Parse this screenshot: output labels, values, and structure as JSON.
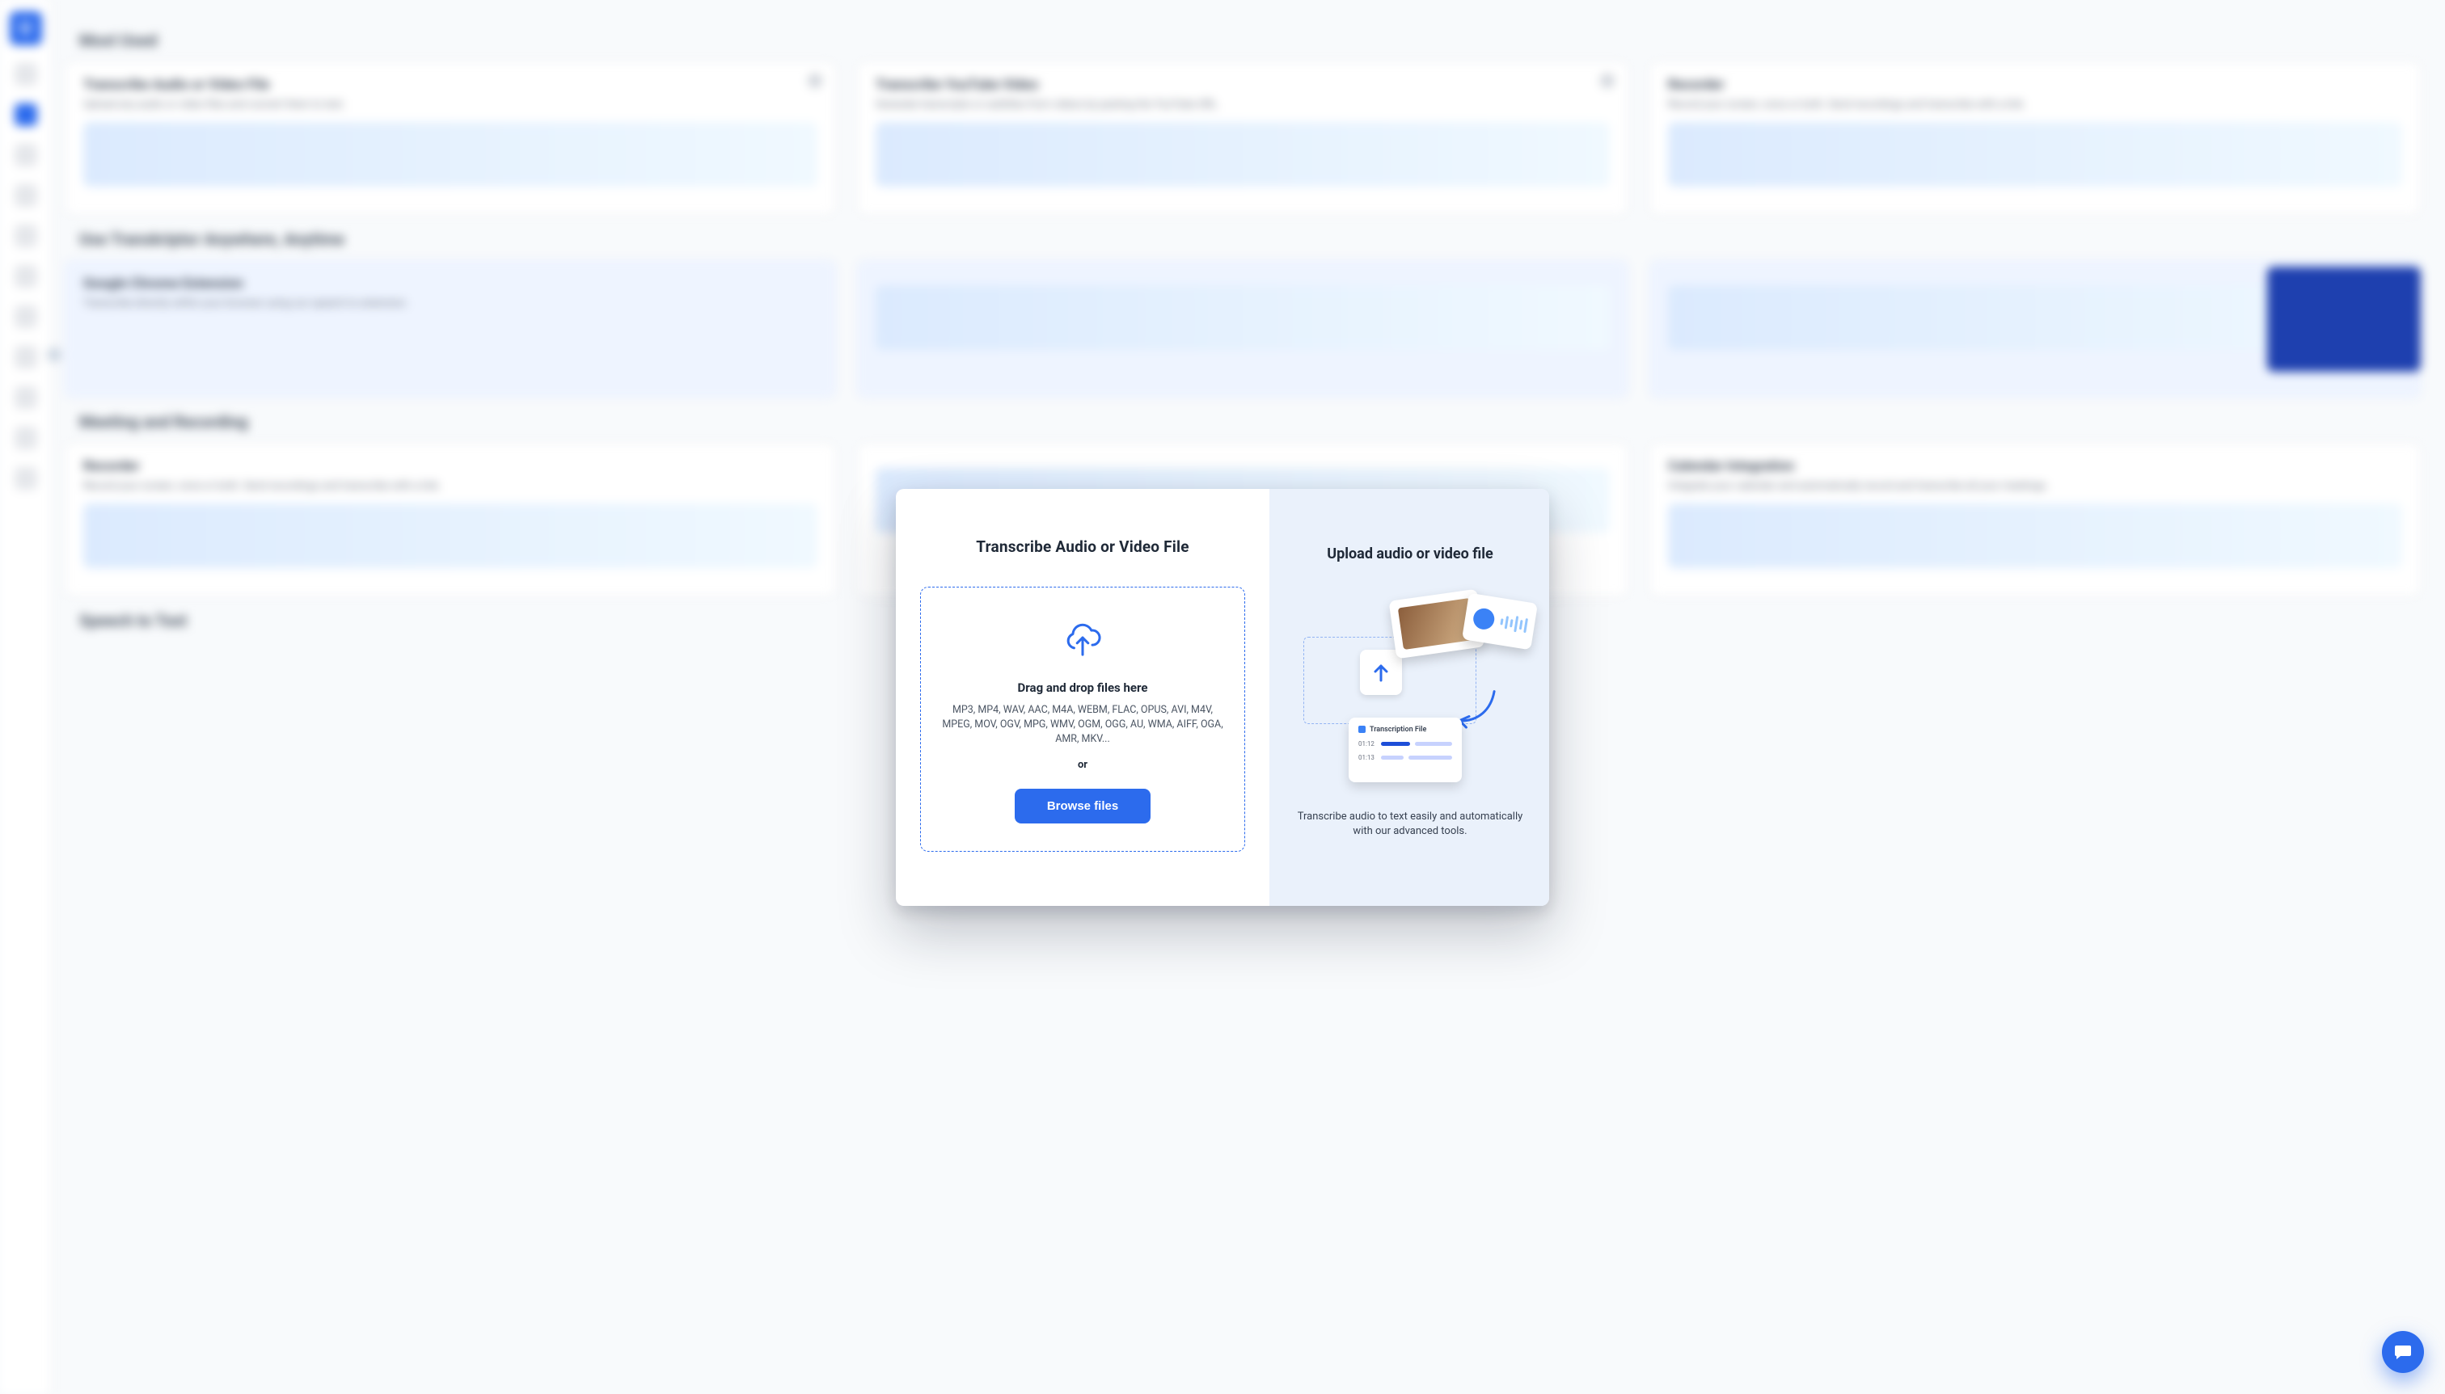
{
  "background": {
    "sections": {
      "most_used": "Most Used",
      "anywhere": "Use Transkriptor Anywhere, Anytime",
      "meeting": "Meeting and Recording",
      "stt": "Speech to Text"
    },
    "cards": {
      "transcribe_file": {
        "title": "Transcribe Audio or Video File",
        "desc": "Upload any audio or video files and convert them to text."
      },
      "transcribe_youtube": {
        "title": "Transcribe YouTube Video",
        "desc": "Generate transcripts or subtitles from videos by pasting the YouTube URL."
      },
      "recorder": {
        "title": "Recorder",
        "desc": "Record your screen, voice or both. Send recordings and transcribe with a link."
      },
      "chrome_ext": {
        "title": "Google Chrome Extension",
        "desc": "Transcribe directly within your browser using our speech to extension."
      },
      "recorder2": {
        "title": "Recorder",
        "desc": "Record your screen, voice or both. Send recordings and transcribe with a link."
      },
      "calendar_int": {
        "title": "Calendar Integration",
        "desc": "Integrate your calendar and automatically record and transcribe all your meetings."
      }
    }
  },
  "modal": {
    "left_title": "Transcribe Audio or Video File",
    "drop_title": "Drag and drop files here",
    "formats": "MP3, MP4, WAV, AAC, M4A, WEBM, FLAC, OPUS, AVI, M4V, MPEG, MOV, OGV, MPG, WMV, OGM, OGG, AU, WMA, AIFF, OGA, AMR, MKV...",
    "or": "or",
    "browse": "Browse files",
    "right_title": "Upload audio or video file",
    "right_desc": "Transcribe audio to text easily and automatically with our advanced tools.",
    "tfile_label": "Transcription File",
    "ts1": "01:12",
    "ts2": "01:13"
  }
}
